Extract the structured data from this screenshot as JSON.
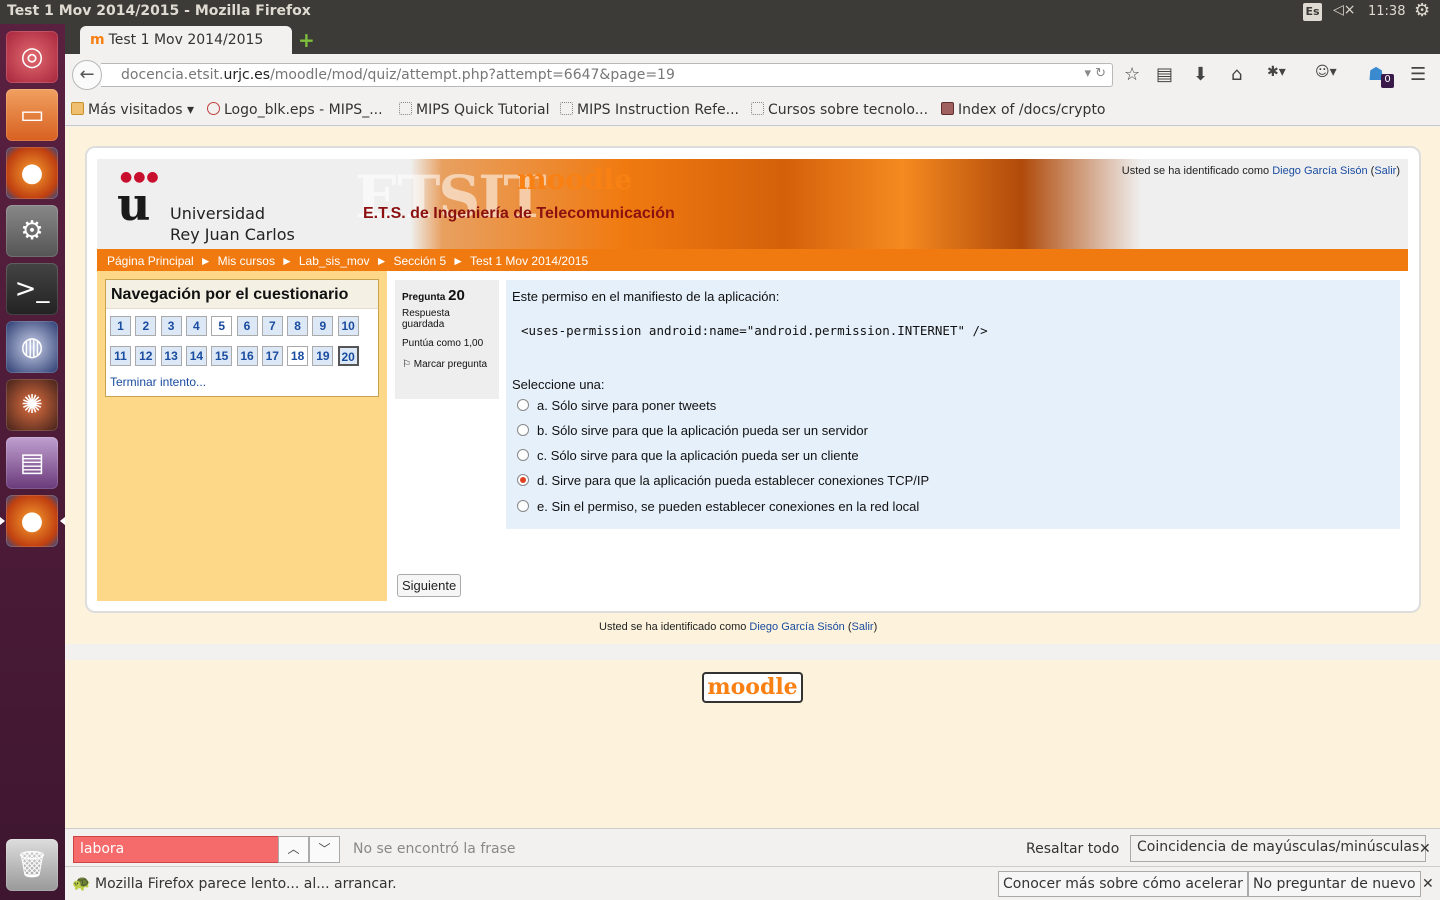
{
  "window": {
    "title": "Test 1 Mov 2014/2015 - Mozilla Firefox",
    "keyboard": "Es",
    "clock": "11:38"
  },
  "tab": {
    "title": "Test 1 Mov 2014/2015"
  },
  "url": {
    "prefix": "docencia.etsit.",
    "host": "urjc.es",
    "path": "/moodle/mod/quiz/attempt.php?attempt=6647&page=19"
  },
  "nav": {
    "badge": "0"
  },
  "bookmarks": [
    {
      "label": "Más visitados ▾"
    },
    {
      "label": "Logo_blk.eps - MIPS_..."
    },
    {
      "label": "MIPS Quick Tutorial"
    },
    {
      "label": "MIPS Instruction Refe..."
    },
    {
      "label": "Cursos sobre tecnolo..."
    },
    {
      "label": "Index of /docs/crypto"
    }
  ],
  "header": {
    "uni_line1": "Universidad",
    "uni_line2": "Rey Juan Carlos",
    "logo_letter": "u",
    "etsit_big": "ETSIT",
    "etsit_sub": "E.T.S. de Ingeniería de Telecomunicación",
    "moodle": "moodle",
    "login_prefix": "Usted se ha identificado como ",
    "login_user": "Diego García Sisón",
    "login_logout": "Salir"
  },
  "breadcrumb": [
    "Página Principal",
    "Mis cursos",
    "Lab_sis_mov",
    "Sección 5",
    "Test 1 Mov 2014/2015"
  ],
  "quiznav": {
    "title": "Navegación por el cuestionario",
    "finish": "Terminar intento..."
  },
  "question": {
    "pregunta_label": "Pregunta",
    "number": "20",
    "status": "Respuesta guardada",
    "score": "Puntúa como 1,00",
    "flag": "Marcar pregunta",
    "text": "Este permiso en el manifiesto de la aplicación:",
    "code": "<uses-permission android:name=\"android.permission.INTERNET\" />",
    "prompt": "Seleccione una:",
    "options": [
      "a. Sólo sirve para poner tweets",
      "b. Sólo sirve para que la aplicación pueda ser un servidor",
      "c. Sólo sirve para que la aplicación pueda ser un cliente",
      "d. Sirve para que la aplicación pueda establecer conexiones TCP/IP",
      "e. Sin el permiso, se pueden establecer conexiones en la red local"
    ],
    "selected_index": 3
  },
  "next_button": "Siguiente",
  "footer": {
    "moodle": "moodle"
  },
  "findbar": {
    "value": "labora",
    "status": "No se encontró la frase",
    "highlight": "Resaltar todo",
    "matchcase": "Coincidencia de mayúsculas/minúsculas"
  },
  "notification": {
    "message": "Mozilla Firefox parece lento... al... arrancar.",
    "learn_more": "Conocer más sobre cómo acelerar",
    "dont_ask": "No preguntar de nuevo"
  }
}
